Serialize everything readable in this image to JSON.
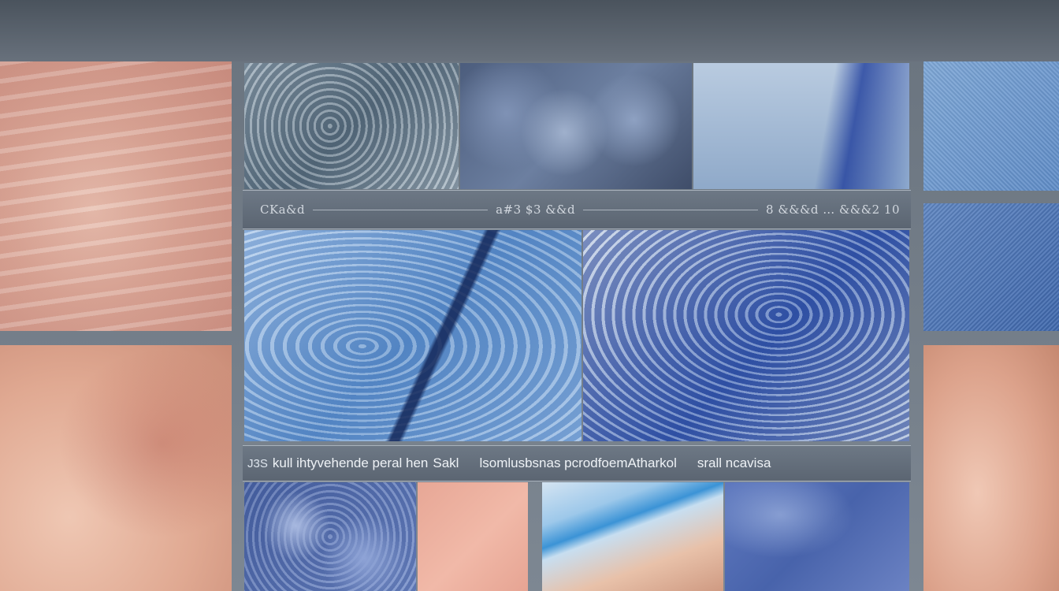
{
  "caption_top": {
    "left": "CKa&d",
    "middle": "a#3 $3 &&d",
    "right": "8 &&&d … &&&2 10"
  },
  "caption_bottom": {
    "mark": "J3S",
    "seg1": "kull ihtyvehende peral hen",
    "seg2": "Sakl",
    "seg3": "lsomlusbsnas pcrodfoemAtharkol",
    "seg4": "srall ncavisa"
  }
}
